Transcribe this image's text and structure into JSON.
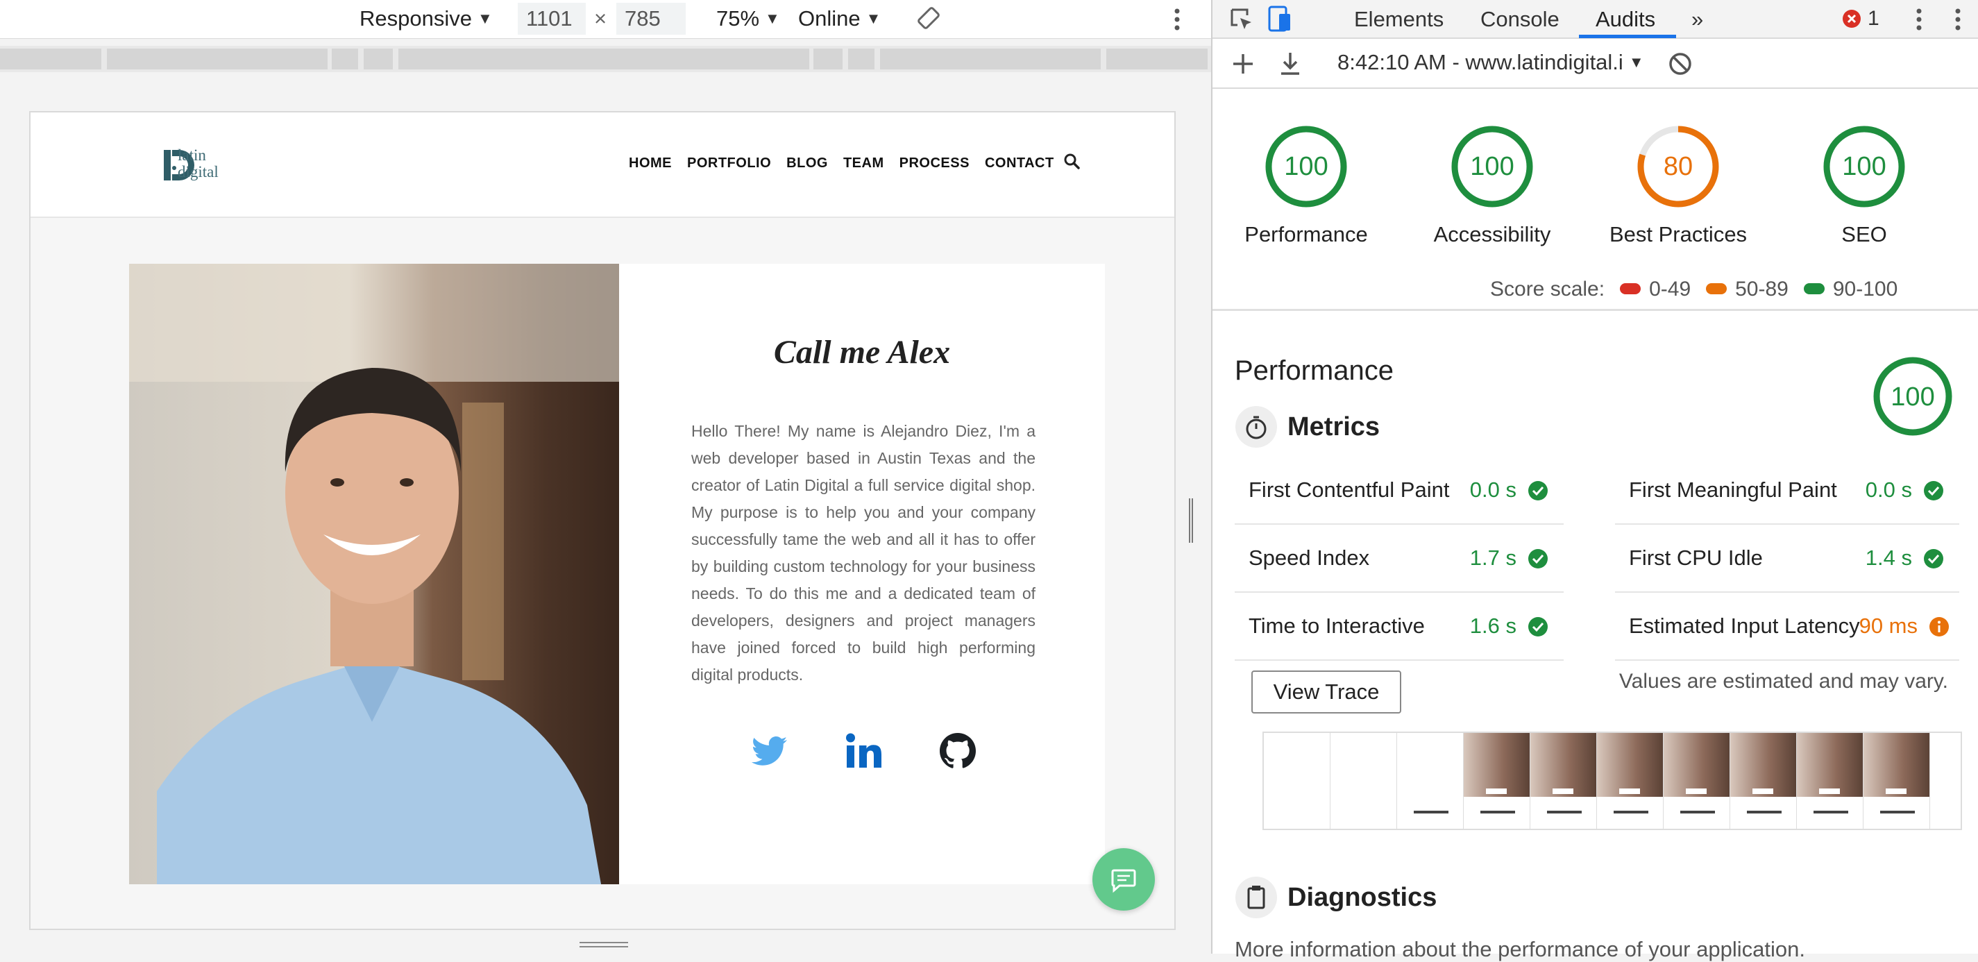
{
  "device_toolbar": {
    "device": "Responsive",
    "width": "1101",
    "times": "×",
    "height": "785",
    "zoom": "75%",
    "network": "Online"
  },
  "site": {
    "logo_line1": "latin",
    "logo_line2": "digital",
    "nav": [
      "HOME",
      "PORTFOLIO",
      "BLOG",
      "TEAM",
      "PROCESS",
      "CONTACT"
    ],
    "title": "Call me Alex",
    "bio": "Hello There! My name is Alejandro Diez, I'm a web developer based in Austin Texas and the creator of Latin Digital a full service digital shop. My purpose is to help you and your company successfully tame the web and all it has to offer by building custom technology for your business needs. To do this me and a dedicated team of developers, designers and project managers have joined forced to build high performing digital products.",
    "social_icons": [
      "twitter-icon",
      "linkedin-icon",
      "github-icon"
    ]
  },
  "devtools": {
    "tabs": [
      "Elements",
      "Console",
      "Audits"
    ],
    "active_tab": "Audits",
    "more_tabs": "»",
    "error_count": "1",
    "report_url": "8:42:10 AM - www.latindigital.i"
  },
  "scores": [
    {
      "label": "Performance",
      "value": "100",
      "color": "#1e8e3e"
    },
    {
      "label": "Accessibility",
      "value": "100",
      "color": "#1e8e3e"
    },
    {
      "label": "Best Practices",
      "value": "80",
      "color": "#e8710a"
    },
    {
      "label": "SEO",
      "value": "100",
      "color": "#1e8e3e"
    }
  ],
  "score_scale": {
    "label": "Score scale:",
    "ranges": [
      {
        "range": "0-49",
        "color": "#d93025"
      },
      {
        "range": "50-89",
        "color": "#e8710a"
      },
      {
        "range": "90-100",
        "color": "#1e8e3e"
      }
    ]
  },
  "performance": {
    "title": "Performance",
    "score": "100",
    "metrics_title": "Metrics",
    "metrics": [
      {
        "name": "First Contentful Paint",
        "value": "0.0 s",
        "status": "pass"
      },
      {
        "name": "First Meaningful Paint",
        "value": "0.0 s",
        "status": "pass"
      },
      {
        "name": "Speed Index",
        "value": "1.7 s",
        "status": "pass"
      },
      {
        "name": "First CPU Idle",
        "value": "1.4 s",
        "status": "pass"
      },
      {
        "name": "Time to Interactive",
        "value": "1.6 s",
        "status": "pass"
      },
      {
        "name": "Estimated Input Latency",
        "value": "90 ms",
        "status": "average"
      }
    ],
    "view_trace": "View Trace",
    "estimate_note": "Values are estimated and may vary.",
    "diagnostics_title": "Diagnostics",
    "diagnostics_text": "More information about the performance of your application."
  },
  "colors": {
    "pass": "#1e8e3e",
    "average": "#e8710a",
    "fail": "#d93025",
    "accent": "#1a73e8",
    "chat": "#62c98c"
  }
}
